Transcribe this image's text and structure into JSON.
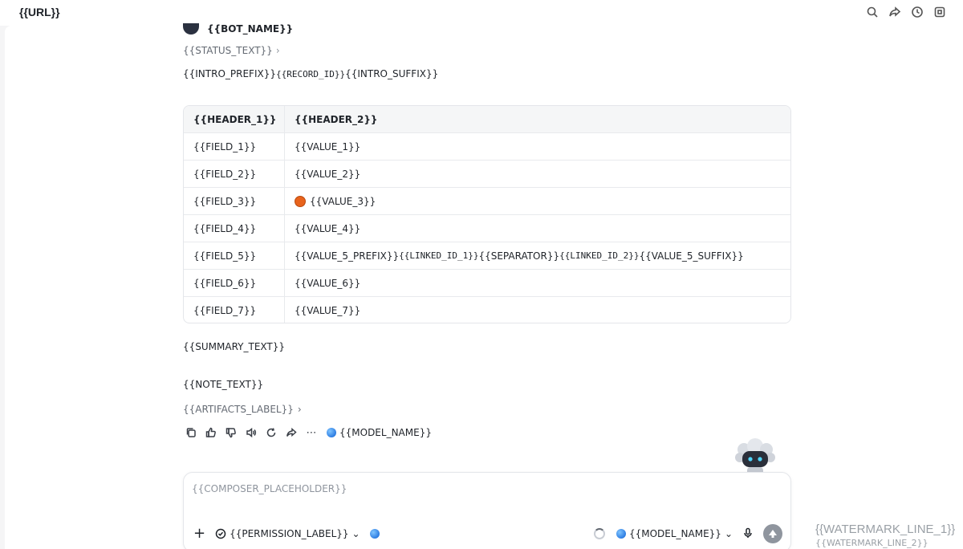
{
  "browser": {
    "url": "{{URL}}"
  },
  "top_icons": [
    "search-icon",
    "share-icon",
    "history-icon",
    "window-icon"
  ],
  "bot": {
    "name": "{{BOT_NAME}}",
    "status": "{{STATUS_TEXT}}"
  },
  "message": {
    "intro_prefix": "{{INTRO_PREFIX}}",
    "intro_id": "{{RECORD_ID}}",
    "intro_suffix": "{{INTRO_SUFFIX}}",
    "table": {
      "headers": [
        "{{HEADER_1}}",
        "{{HEADER_2}}"
      ],
      "rows": [
        {
          "field": "{{FIELD_1}}",
          "value": "{{VALUE_1}}"
        },
        {
          "field": "{{FIELD_2}}",
          "value": "{{VALUE_2}}"
        },
        {
          "field": "{{FIELD_3}}",
          "value": "{{VALUE_3}}",
          "status_color": "#e8631c"
        },
        {
          "field": "{{FIELD_4}}",
          "value": "{{VALUE_4}}"
        },
        {
          "field": "{{FIELD_5}}",
          "value_prefix": "{{VALUE_5_PREFIX}}",
          "id_1": "{{LINKED_ID_1}}",
          "sep": "{{SEPARATOR}}",
          "id_2": "{{LINKED_ID_2}}",
          "value_suffix": "{{VALUE_5_SUFFIX}}"
        },
        {
          "field": "{{FIELD_6}}",
          "value": "{{VALUE_6}}"
        },
        {
          "field": "{{FIELD_7}}",
          "value": "{{VALUE_7}}"
        }
      ]
    },
    "summary": "{{SUMMARY_TEXT}}",
    "note": "{{NOTE_TEXT}}",
    "artifacts_label": "{{ARTIFACTS_LABEL}}"
  },
  "actions": {
    "icons": [
      "copy-icon",
      "thumbs-up-icon",
      "thumbs-down-icon",
      "speaker-icon",
      "refresh-icon",
      "share-icon",
      "more-icon"
    ],
    "model": "{{MODEL_NAME}}"
  },
  "composer": {
    "placeholder": "{{COMPOSER_PLACEHOLDER}}",
    "permission_label": "{{PERMISSION_LABEL}}",
    "model": "{{MODEL_NAME}}"
  },
  "watermark": {
    "line1": "{{WATERMARK_LINE_1}}",
    "line2": "{{WATERMARK_LINE_2}}"
  },
  "colors": {
    "status_dot": "#e8631c",
    "send_button": "#8f959e"
  }
}
